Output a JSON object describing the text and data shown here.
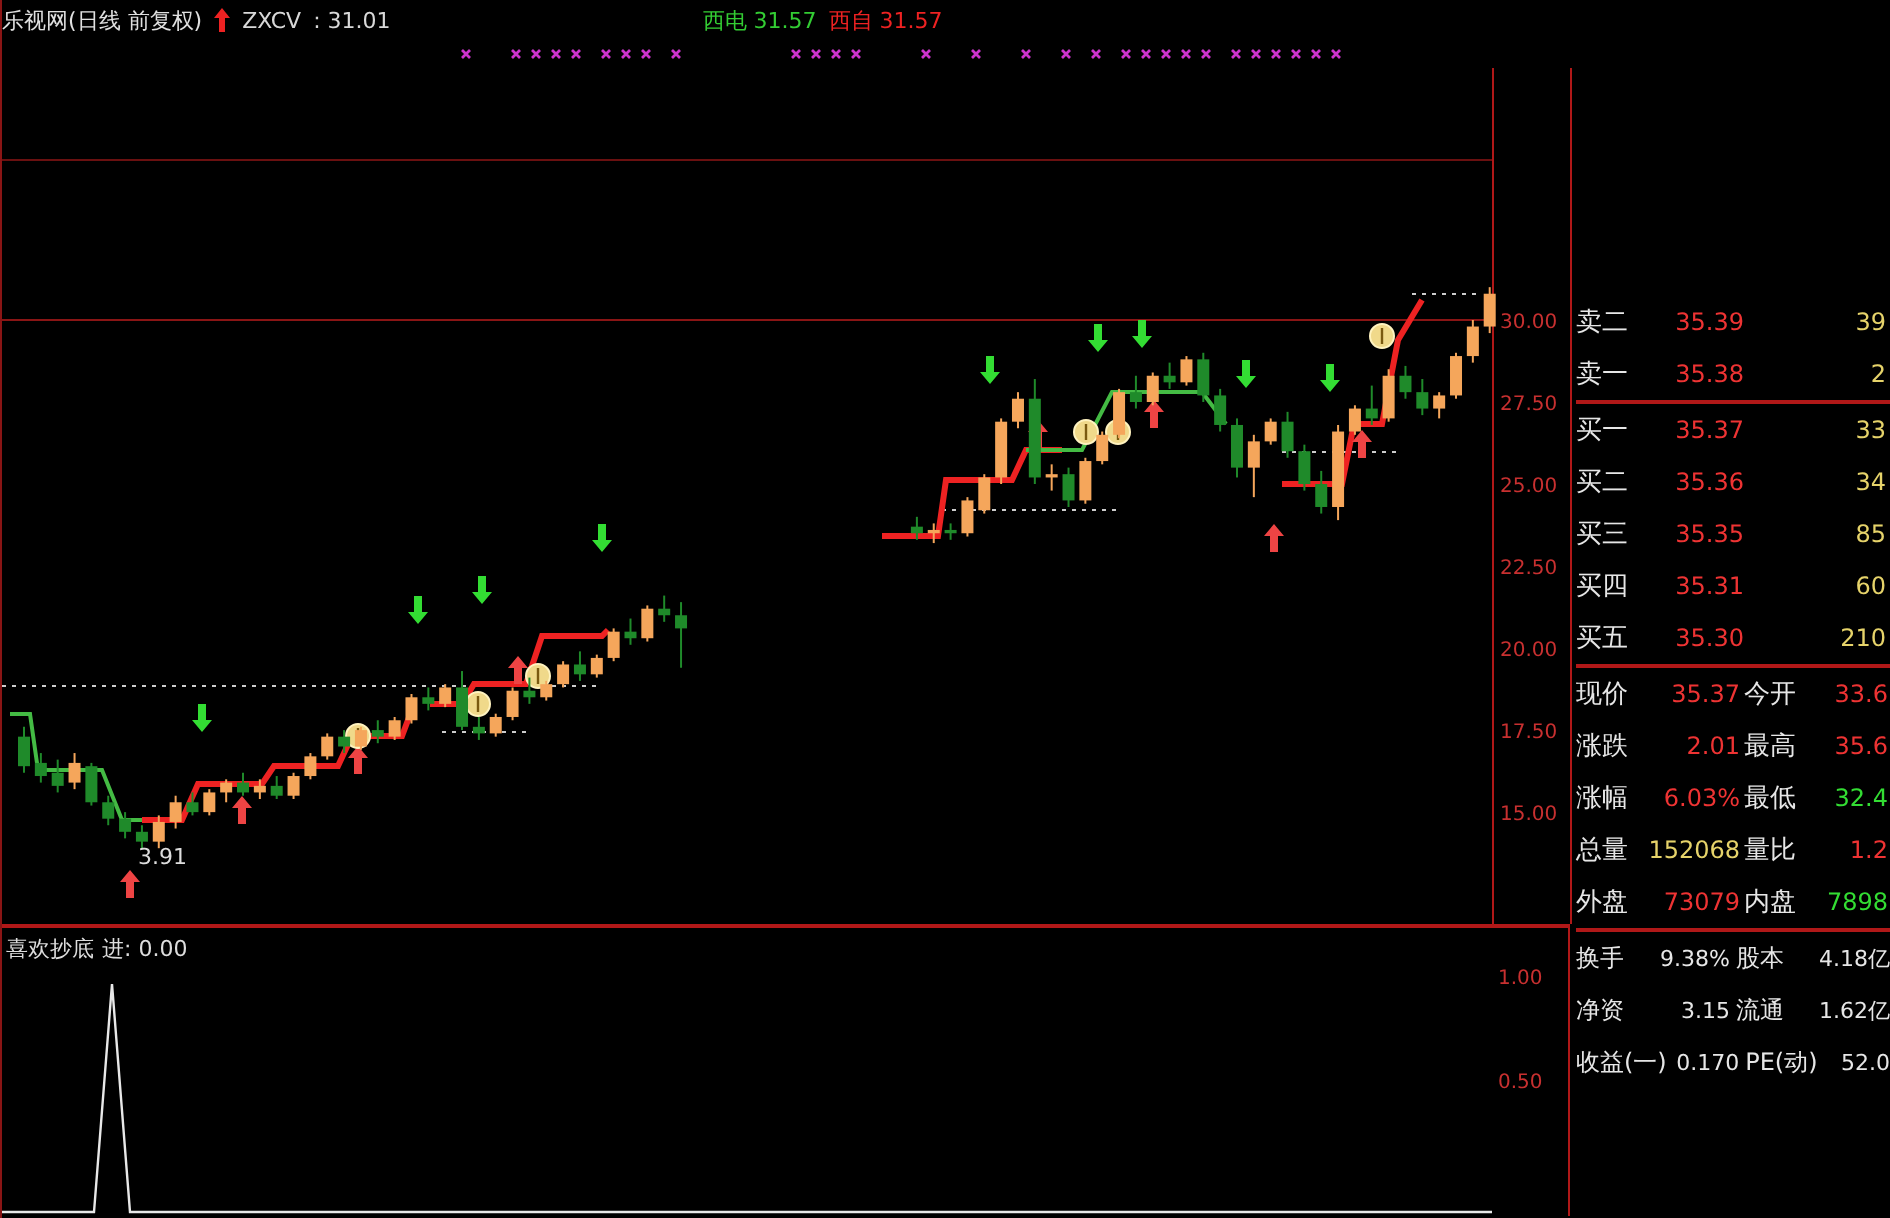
{
  "header": {
    "title": "乐视网(日线 前复权)",
    "indicator": "ZXCV",
    "indicator_value": ": 31.01",
    "signals": [
      {
        "label": "西电",
        "value": "31.57",
        "color": "#33cc33"
      },
      {
        "label": "西自",
        "value": "31.57",
        "color": "#ee2222"
      }
    ]
  },
  "main_chart": {
    "low_label": "3.91",
    "chart_data": {
      "type": "candlestick",
      "ylim": [
        11.59,
        37.68
      ],
      "categories": [
        null,
        null,
        null,
        null,
        null,
        null,
        null,
        null,
        null,
        null,
        null,
        null,
        null,
        null,
        null,
        null,
        null,
        null,
        null,
        null,
        null,
        null,
        null,
        null,
        null,
        null,
        null,
        null,
        null,
        null,
        null,
        null,
        null,
        null,
        null,
        null,
        null,
        null,
        null,
        null,
        null,
        null,
        null,
        null,
        null,
        null,
        null,
        null,
        null,
        null,
        null,
        null,
        null,
        null,
        null,
        null,
        null,
        null,
        null,
        null,
        null,
        null,
        null,
        null,
        null,
        null,
        null,
        null,
        null,
        null,
        null,
        null,
        null,
        null,
        null,
        null,
        null,
        null,
        null,
        null,
        null,
        null,
        null,
        null,
        null,
        null,
        null,
        null
      ],
      "yticks": [
        {
          "value": 30,
          "label": "30.00"
        },
        {
          "value": 27.5,
          "label": "27.50"
        },
        {
          "value": 25,
          "label": "25.00"
        },
        {
          "value": 22.5,
          "label": "22.50"
        },
        {
          "value": 20,
          "label": "20.00"
        },
        {
          "value": 17.5,
          "label": "17.50"
        },
        {
          "value": 15,
          "label": "15.00"
        }
      ],
      "ohlc": [
        [
          17.3,
          17.6,
          16.2,
          16.4
        ],
        [
          16.5,
          16.8,
          15.9,
          16.1
        ],
        [
          16.2,
          16.6,
          15.6,
          15.8
        ],
        [
          15.9,
          16.8,
          15.7,
          16.5
        ],
        [
          16.4,
          16.5,
          15.2,
          15.3
        ],
        [
          15.3,
          15.5,
          14.6,
          14.8
        ],
        [
          14.8,
          15.0,
          14.2,
          14.4
        ],
        [
          14.4,
          14.6,
          13.9,
          14.1
        ],
        [
          14.1,
          14.9,
          13.9,
          14.7
        ],
        [
          14.7,
          15.5,
          14.5,
          15.3
        ],
        [
          15.3,
          15.6,
          14.9,
          15.0
        ],
        [
          15.0,
          15.7,
          14.9,
          15.6
        ],
        [
          15.6,
          16.0,
          15.3,
          15.9
        ],
        [
          15.9,
          16.2,
          15.5,
          15.6
        ],
        [
          15.6,
          16.0,
          15.4,
          15.8
        ],
        [
          15.8,
          16.1,
          15.4,
          15.5
        ],
        [
          15.5,
          16.2,
          15.4,
          16.1
        ],
        [
          16.1,
          16.8,
          16.0,
          16.7
        ],
        [
          16.7,
          17.4,
          16.6,
          17.3
        ],
        [
          17.3,
          17.5,
          16.8,
          17.0
        ],
        [
          17.0,
          17.6,
          16.9,
          17.5
        ],
        [
          17.5,
          17.8,
          17.1,
          17.3
        ],
        [
          17.3,
          17.9,
          17.2,
          17.8
        ],
        [
          17.8,
          18.6,
          17.7,
          18.5
        ],
        [
          18.5,
          18.8,
          18.1,
          18.3
        ],
        [
          18.3,
          18.9,
          18.2,
          18.8
        ],
        [
          18.8,
          19.3,
          17.5,
          17.6
        ],
        [
          17.6,
          17.9,
          17.2,
          17.4
        ],
        [
          17.4,
          18.0,
          17.3,
          17.9
        ],
        [
          17.9,
          18.8,
          17.8,
          18.7
        ],
        [
          18.7,
          19.1,
          18.3,
          18.5
        ],
        [
          18.5,
          19.0,
          18.4,
          18.9
        ],
        [
          18.9,
          19.6,
          18.8,
          19.5
        ],
        [
          19.5,
          19.9,
          19.0,
          19.2
        ],
        [
          19.2,
          19.8,
          19.1,
          19.7
        ],
        [
          19.7,
          20.6,
          19.6,
          20.5
        ],
        [
          20.5,
          20.9,
          20.1,
          20.3
        ],
        [
          20.3,
          21.3,
          20.2,
          21.2
        ],
        [
          21.2,
          21.6,
          20.8,
          21.0
        ],
        [
          21.0,
          21.4,
          19.4,
          20.6
        ],
        null,
        null,
        null,
        null,
        null,
        null,
        null,
        null,
        null,
        null,
        null,
        null,
        null,
        [
          23.7,
          24.0,
          23.3,
          23.5
        ],
        [
          23.5,
          23.8,
          23.2,
          23.6
        ],
        [
          23.6,
          23.8,
          23.3,
          23.5
        ],
        [
          23.5,
          24.6,
          23.4,
          24.5
        ],
        [
          24.2,
          25.3,
          24.1,
          25.2
        ],
        [
          25.2,
          27.0,
          25.0,
          26.9
        ],
        [
          26.9,
          27.8,
          26.7,
          27.6
        ],
        [
          27.6,
          28.2,
          25.0,
          25.2
        ],
        [
          25.2,
          25.6,
          24.8,
          25.3
        ],
        [
          25.3,
          25.5,
          24.3,
          24.5
        ],
        [
          24.5,
          25.8,
          24.4,
          25.7
        ],
        [
          25.7,
          26.6,
          25.6,
          26.5
        ],
        [
          26.5,
          27.9,
          26.4,
          27.8
        ],
        [
          27.8,
          28.3,
          27.3,
          27.5
        ],
        [
          27.5,
          28.4,
          27.4,
          28.3
        ],
        [
          28.3,
          28.7,
          27.9,
          28.1
        ],
        [
          28.1,
          28.9,
          28.0,
          28.8
        ],
        [
          28.8,
          29.0,
          27.5,
          27.7
        ],
        [
          27.7,
          27.9,
          26.6,
          26.8
        ],
        [
          26.8,
          27.0,
          25.2,
          25.5
        ],
        [
          25.5,
          26.5,
          24.6,
          26.3
        ],
        [
          26.3,
          27.0,
          26.2,
          26.9
        ],
        [
          26.9,
          27.2,
          25.8,
          26.0
        ],
        [
          26.0,
          26.2,
          24.8,
          25.0
        ],
        [
          25.0,
          25.4,
          24.1,
          24.3
        ],
        [
          24.3,
          26.8,
          23.9,
          26.6
        ],
        [
          26.6,
          27.4,
          26.5,
          27.3
        ],
        [
          27.3,
          28.0,
          26.8,
          27.0
        ],
        [
          27.0,
          28.5,
          26.9,
          28.3
        ],
        [
          28.3,
          28.6,
          27.6,
          27.8
        ],
        [
          27.8,
          28.2,
          27.1,
          27.3
        ],
        [
          27.3,
          27.8,
          27.0,
          27.7
        ],
        [
          27.7,
          29.0,
          27.6,
          28.9
        ],
        [
          28.9,
          30.0,
          28.7,
          29.8
        ],
        [
          29.8,
          31.0,
          29.6,
          30.8
        ]
      ]
    }
  },
  "sub_chart": {
    "title": "喜欢抄底",
    "reading_label": "进:",
    "reading": "0.00",
    "axis": [
      "1.00",
      "0.50"
    ]
  },
  "order_book": [
    {
      "label": "卖二",
      "price": "35.39",
      "volume": "39"
    },
    {
      "label": "卖一",
      "price": "35.38",
      "volume": "2"
    },
    {
      "label": "买一",
      "price": "35.37",
      "volume": "33"
    },
    {
      "label": "买二",
      "price": "35.36",
      "volume": "34"
    },
    {
      "label": "买三",
      "price": "35.35",
      "volume": "85"
    },
    {
      "label": "买四",
      "price": "35.31",
      "volume": "60"
    },
    {
      "label": "买五",
      "price": "35.30",
      "volume": "210"
    }
  ],
  "quote": [
    {
      "cells": [
        {
          "label": "现价",
          "value": "35.37",
          "color": "#ee3333"
        },
        {
          "label": "今开",
          "value": "33.6",
          "color": "#ee3333"
        }
      ]
    },
    {
      "cells": [
        {
          "label": "涨跌",
          "value": "2.01",
          "color": "#ee3333"
        },
        {
          "label": "最高",
          "value": "35.6",
          "color": "#ee3333"
        }
      ]
    },
    {
      "cells": [
        {
          "label": "涨幅",
          "value": "6.03%",
          "color": "#ee3333"
        },
        {
          "label": "最低",
          "value": "32.4",
          "color": "#33dd33"
        }
      ]
    },
    {
      "cells": [
        {
          "label": "总量",
          "value": "152068",
          "color": "#e6d36a"
        },
        {
          "label": "量比",
          "value": "1.2",
          "color": "#ee3333"
        }
      ]
    },
    {
      "cells": [
        {
          "label": "外盘",
          "value": "73079",
          "color": "#ee3333"
        },
        {
          "label": "内盘",
          "value": "7898",
          "color": "#33dd33"
        }
      ]
    }
  ],
  "fundamentals": [
    {
      "label": "换手",
      "value": "9.38%",
      "label2": "股本",
      "value2": "4.18亿"
    },
    {
      "label": "净资",
      "value": "3.15",
      "label2": "流通",
      "value2": "1.62亿"
    },
    {
      "label": "收益(一)",
      "value": "0.170",
      "label2": "PE(动)",
      "value2": "52.0"
    }
  ]
}
